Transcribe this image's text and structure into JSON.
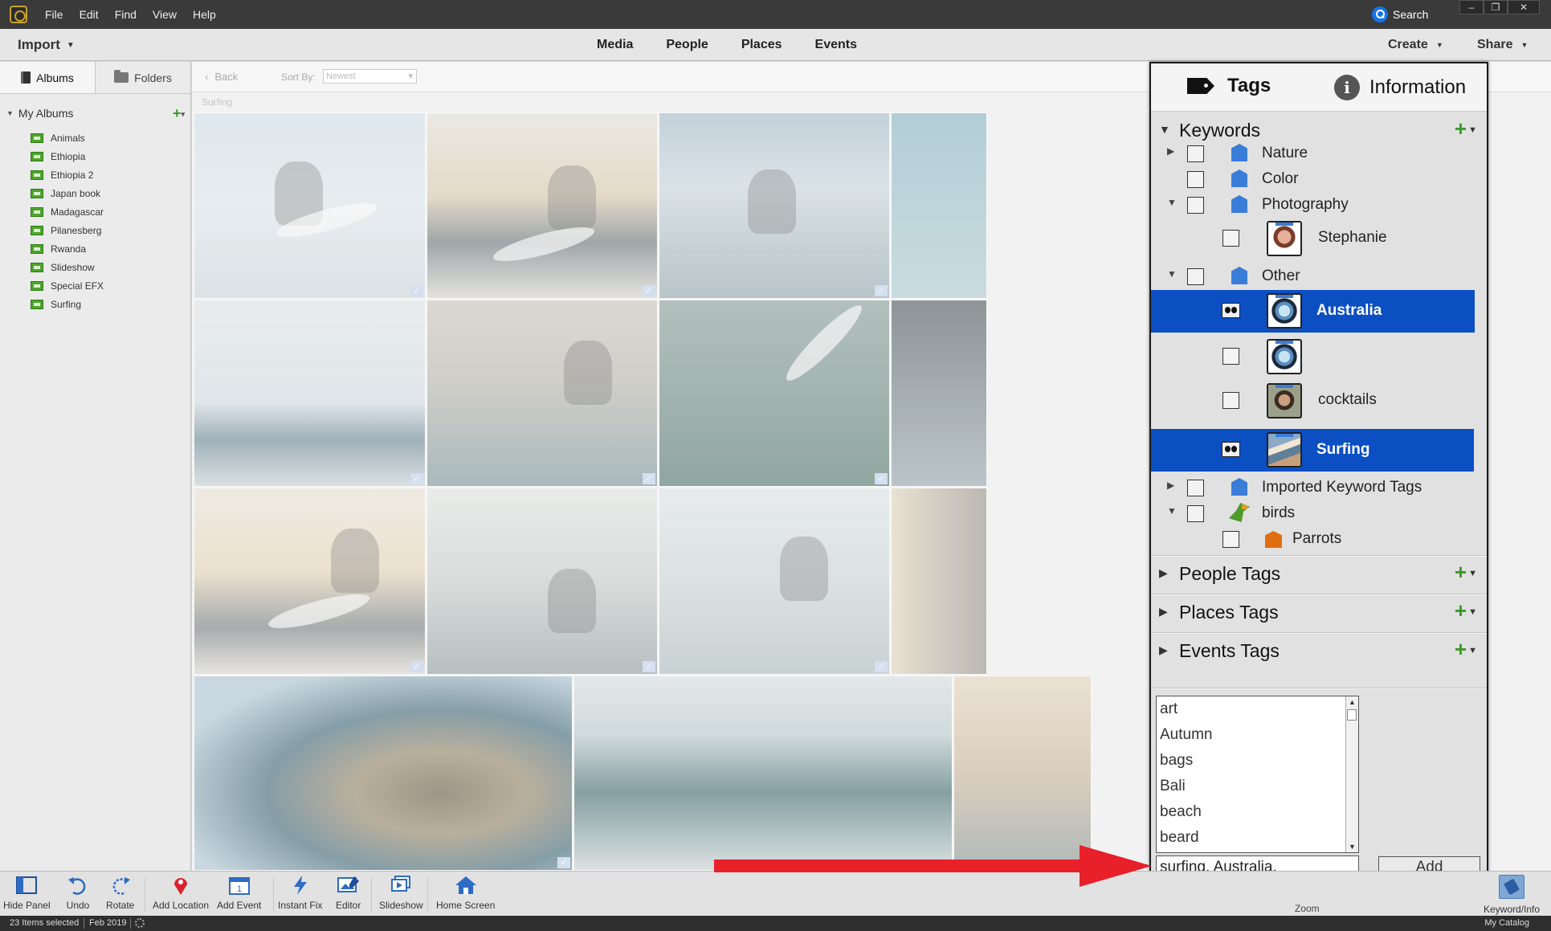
{
  "titlebar": {
    "menus": [
      "File",
      "Edit",
      "Find",
      "View",
      "Help"
    ],
    "search_label": "Search",
    "window_controls": [
      "–",
      "❐",
      "✕"
    ]
  },
  "topnav": {
    "import_label": "Import",
    "views": [
      "Media",
      "People",
      "Places",
      "Events"
    ],
    "create_label": "Create",
    "share_label": "Share"
  },
  "left_panel": {
    "tabs": [
      "Albums",
      "Folders"
    ],
    "my_albums_label": "My Albums",
    "albums": [
      "Animals",
      "Ethiopia",
      "Ethiopia 2",
      "Japan book",
      "Madagascar",
      "Pilanesberg",
      "Rwanda",
      "Slideshow",
      "Special EFX",
      "Surfing"
    ]
  },
  "browser": {
    "back_label": "Back",
    "sort_by_label": "Sort By:",
    "sort_value": "Newest",
    "album_title": "Surfing"
  },
  "tags_panel": {
    "tabs": {
      "tags": "Tags",
      "information": "Information"
    },
    "sections": {
      "keywords": "Keywords",
      "people": "People Tags",
      "places": "Places Tags",
      "events": "Events Tags"
    },
    "keywords": {
      "nature": "Nature",
      "color": "Color",
      "photography": "Photography",
      "stephanie": "Stephanie",
      "other": "Other",
      "australia": "Australia",
      "unnamed": "",
      "cocktails": "cocktails",
      "surfing": "Surfing",
      "imported": "Imported Keyword Tags",
      "birds": "birds",
      "parrots": "Parrots"
    },
    "keyword_list": [
      "art",
      "Autumn",
      "bags",
      "Bali",
      "beach",
      "beard"
    ],
    "keyword_input_value": "surfing, Australia,",
    "add_label": "Add"
  },
  "bottom_toolbar": {
    "items": [
      "Hide Panel",
      "Undo",
      "Rotate",
      "Add Location",
      "Add Event",
      "Instant Fix",
      "Editor",
      "Slideshow",
      "Home Screen"
    ],
    "zoom_label": "Zoom",
    "keyword_info_label": "Keyword/Info"
  },
  "statusbar": {
    "selected": "23 Items selected",
    "date": "Feb 2019",
    "catalog": "My Catalog"
  },
  "colors": {
    "selection_blue": "#0b4fc3",
    "arrow_red": "#e8202a",
    "add_green": "#3c9a2a"
  }
}
